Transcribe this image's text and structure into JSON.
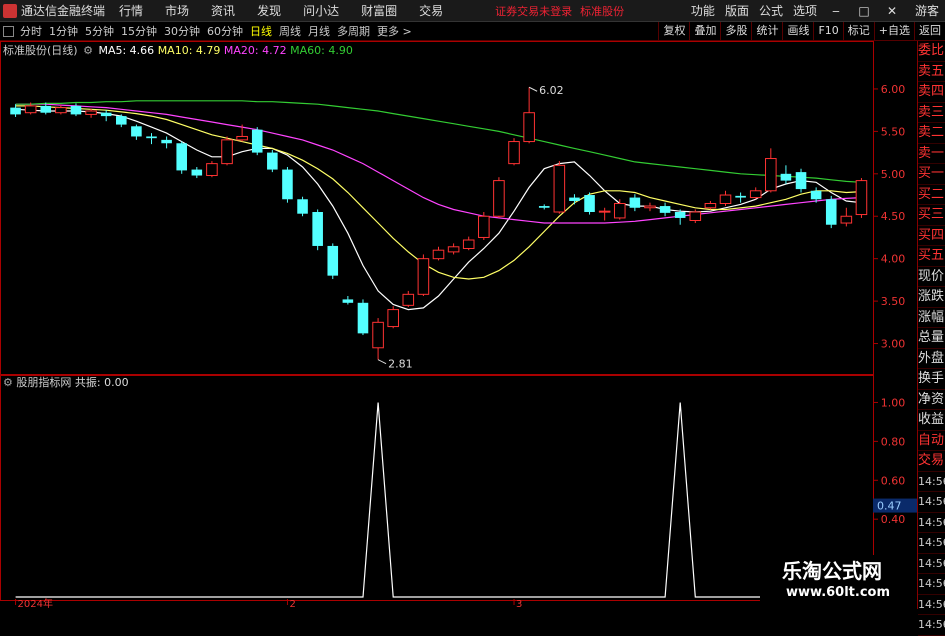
{
  "menubar": {
    "app_title": "通达信金融终端",
    "menus": [
      "行情",
      "市场",
      "资讯",
      "发现",
      "问小达",
      "财富圈",
      "交易"
    ],
    "warning": "证券交易未登录",
    "stock_name": "标准股份",
    "right_items": [
      "功能",
      "版面",
      "公式",
      "选项",
      "游客"
    ],
    "win_buttons": [
      "‒",
      "□",
      "✕"
    ]
  },
  "toolbar": {
    "periods": [
      "分时",
      "1分钟",
      "5分钟",
      "15分钟",
      "30分钟",
      "60分钟",
      "日线",
      "周线",
      "月线",
      "多周期",
      "更多 >"
    ],
    "active_period": "日线",
    "right_buttons": [
      "复权",
      "叠加",
      "多股",
      "统计",
      "画线",
      "F10",
      "标记",
      "+自选",
      "返回"
    ]
  },
  "legend_main": {
    "title": "标准股份(日线)",
    "ma5_label": "MA5: 4.66",
    "ma10_label": "MA10: 4.79",
    "ma20_label": "MA20: 4.72",
    "ma60_label": "MA60: 4.90"
  },
  "legend_sub": {
    "title": "股朋指标网",
    "value_label": "共振: 0.00"
  },
  "side_panel": {
    "items": [
      "委比",
      "卖五",
      "卖四",
      "卖三",
      "卖二",
      "卖一",
      "买一",
      "买二",
      "买三",
      "买四",
      "买五",
      "现价",
      "涨跌",
      "涨幅",
      "总量",
      "外盘",
      "换手",
      "净资",
      "收益",
      "自动",
      "交易",
      "14:56",
      "14:56",
      "14:56",
      "14:56",
      "14:56",
      "14:56",
      "14:56",
      "14:56"
    ],
    "highlight_value": "0.47"
  },
  "watermark": {
    "line1": "乐淘公式网",
    "line2": "www.60lt.com"
  },
  "colors": {
    "up": "#ff3333",
    "down": "#54ffff",
    "ma5": "#ffffff",
    "ma10": "#ffff66",
    "ma20": "#ff44ff",
    "ma60": "#33cc33",
    "axis": "#aa0000"
  },
  "chart_data": [
    {
      "type": "candlestick",
      "ylim": [
        2.7,
        6.4
      ],
      "yticks": [
        3.0,
        3.5,
        4.0,
        4.5,
        5.0,
        5.5,
        6.0
      ],
      "annotations": [
        {
          "label": "6.02",
          "index": 34,
          "value": 6.02
        },
        {
          "label": "2.81",
          "index": 24,
          "value": 2.81
        }
      ],
      "candles": [
        {
          "o": 5.78,
          "c": 5.7,
          "h": 5.82,
          "l": 5.67
        },
        {
          "o": 5.72,
          "c": 5.8,
          "h": 5.84,
          "l": 5.7
        },
        {
          "o": 5.8,
          "c": 5.72,
          "h": 5.84,
          "l": 5.7
        },
        {
          "o": 5.72,
          "c": 5.78,
          "h": 5.81,
          "l": 5.7
        },
        {
          "o": 5.8,
          "c": 5.7,
          "h": 5.83,
          "l": 5.68
        },
        {
          "o": 5.7,
          "c": 5.74,
          "h": 5.77,
          "l": 5.66
        },
        {
          "o": 5.72,
          "c": 5.68,
          "h": 5.75,
          "l": 5.62
        },
        {
          "o": 5.68,
          "c": 5.58,
          "h": 5.7,
          "l": 5.55
        },
        {
          "o": 5.56,
          "c": 5.44,
          "h": 5.58,
          "l": 5.4
        },
        {
          "o": 5.44,
          "c": 5.42,
          "h": 5.48,
          "l": 5.35
        },
        {
          "o": 5.4,
          "c": 5.36,
          "h": 5.44,
          "l": 5.3
        },
        {
          "o": 5.36,
          "c": 5.04,
          "h": 5.38,
          "l": 5.0
        },
        {
          "o": 5.05,
          "c": 4.98,
          "h": 5.08,
          "l": 4.95
        },
        {
          "o": 4.98,
          "c": 5.12,
          "h": 5.15,
          "l": 4.96
        },
        {
          "o": 5.12,
          "c": 5.4,
          "h": 5.44,
          "l": 5.1
        },
        {
          "o": 5.4,
          "c": 5.44,
          "h": 5.58,
          "l": 5.38
        },
        {
          "o": 5.52,
          "c": 5.25,
          "h": 5.55,
          "l": 5.22
        },
        {
          "o": 5.25,
          "c": 5.05,
          "h": 5.28,
          "l": 5.02
        },
        {
          "o": 5.05,
          "c": 4.7,
          "h": 5.08,
          "l": 4.66
        },
        {
          "o": 4.7,
          "c": 4.53,
          "h": 4.73,
          "l": 4.5
        },
        {
          "o": 4.55,
          "c": 4.15,
          "h": 4.58,
          "l": 4.1
        },
        {
          "o": 4.15,
          "c": 3.8,
          "h": 4.18,
          "l": 3.76
        },
        {
          "o": 3.52,
          "c": 3.48,
          "h": 3.56,
          "l": 3.46
        },
        {
          "o": 3.48,
          "c": 3.12,
          "h": 3.52,
          "l": 3.1
        },
        {
          "o": 2.95,
          "c": 3.25,
          "h": 3.3,
          "l": 2.81
        },
        {
          "o": 3.2,
          "c": 3.4,
          "h": 3.44,
          "l": 3.18
        },
        {
          "o": 3.45,
          "c": 3.58,
          "h": 3.62,
          "l": 3.43
        },
        {
          "o": 3.58,
          "c": 4.0,
          "h": 4.05,
          "l": 3.56
        },
        {
          "o": 4.0,
          "c": 4.1,
          "h": 4.14,
          "l": 3.98
        },
        {
          "o": 4.08,
          "c": 4.14,
          "h": 4.18,
          "l": 4.05
        },
        {
          "o": 4.12,
          "c": 4.22,
          "h": 4.26,
          "l": 4.1
        },
        {
          "o": 4.25,
          "c": 4.5,
          "h": 4.55,
          "l": 4.22
        },
        {
          "o": 4.5,
          "c": 4.92,
          "h": 4.96,
          "l": 4.48
        },
        {
          "o": 5.12,
          "c": 5.38,
          "h": 5.42,
          "l": 5.1
        },
        {
          "o": 5.38,
          "c": 5.72,
          "h": 6.02,
          "l": 5.36
        },
        {
          "o": 4.62,
          "c": 4.6,
          "h": 4.64,
          "l": 4.58
        },
        {
          "o": 4.55,
          "c": 5.1,
          "h": 5.15,
          "l": 4.53
        },
        {
          "o": 4.72,
          "c": 4.68,
          "h": 4.76,
          "l": 4.64
        },
        {
          "o": 4.75,
          "c": 4.55,
          "h": 4.78,
          "l": 4.52
        },
        {
          "o": 4.55,
          "c": 4.56,
          "h": 4.6,
          "l": 4.45
        },
        {
          "o": 4.48,
          "c": 4.65,
          "h": 4.7,
          "l": 4.46
        },
        {
          "o": 4.72,
          "c": 4.6,
          "h": 4.76,
          "l": 4.56
        },
        {
          "o": 4.6,
          "c": 4.62,
          "h": 4.66,
          "l": 4.56
        },
        {
          "o": 4.62,
          "c": 4.54,
          "h": 4.66,
          "l": 4.5
        },
        {
          "o": 4.55,
          "c": 4.48,
          "h": 4.58,
          "l": 4.4
        },
        {
          "o": 4.45,
          "c": 4.55,
          "h": 4.58,
          "l": 4.42
        },
        {
          "o": 4.6,
          "c": 4.65,
          "h": 4.68,
          "l": 4.58
        },
        {
          "o": 4.65,
          "c": 4.75,
          "h": 4.8,
          "l": 4.62
        },
        {
          "o": 4.74,
          "c": 4.72,
          "h": 4.78,
          "l": 4.66
        },
        {
          "o": 4.72,
          "c": 4.8,
          "h": 4.84,
          "l": 4.7
        },
        {
          "o": 4.8,
          "c": 5.18,
          "h": 5.3,
          "l": 4.78
        },
        {
          "o": 5.0,
          "c": 4.92,
          "h": 5.1,
          "l": 4.88
        },
        {
          "o": 5.02,
          "c": 4.82,
          "h": 5.06,
          "l": 4.78
        },
        {
          "o": 4.8,
          "c": 4.7,
          "h": 4.84,
          "l": 4.66
        },
        {
          "o": 4.7,
          "c": 4.4,
          "h": 4.74,
          "l": 4.36
        },
        {
          "o": 4.42,
          "c": 4.5,
          "h": 4.6,
          "l": 4.38
        },
        {
          "o": 4.52,
          "c": 4.92,
          "h": 4.95,
          "l": 4.48
        }
      ],
      "ma_series": [
        {
          "name": "MA5",
          "values": [
            5.76,
            5.75,
            5.74,
            5.74,
            5.74,
            5.73,
            5.71,
            5.68,
            5.62,
            5.55,
            5.48,
            5.38,
            5.28,
            5.2,
            5.2,
            5.26,
            5.3,
            5.3,
            5.22,
            5.08,
            4.88,
            4.62,
            4.3,
            3.92,
            3.62,
            3.46,
            3.4,
            3.42,
            3.56,
            3.76,
            3.96,
            4.12,
            4.3,
            4.56,
            4.84,
            5.06,
            5.12,
            5.14,
            4.98,
            4.8,
            4.65,
            4.62,
            4.62,
            4.58,
            4.56,
            4.55,
            4.56,
            4.6,
            4.64,
            4.7,
            4.82,
            4.88,
            4.92,
            4.9,
            4.78,
            4.68,
            4.66
          ]
        },
        {
          "name": "MA10",
          "values": [
            5.8,
            5.8,
            5.79,
            5.78,
            5.77,
            5.76,
            5.75,
            5.73,
            5.71,
            5.68,
            5.64,
            5.58,
            5.52,
            5.46,
            5.42,
            5.38,
            5.34,
            5.3,
            5.24,
            5.16,
            5.06,
            4.94,
            4.78,
            4.6,
            4.42,
            4.24,
            4.08,
            3.94,
            3.84,
            3.78,
            3.76,
            3.78,
            3.86,
            3.98,
            4.14,
            4.32,
            4.5,
            4.66,
            4.76,
            4.8,
            4.8,
            4.78,
            4.72,
            4.68,
            4.64,
            4.6,
            4.58,
            4.58,
            4.6,
            4.62,
            4.66,
            4.7,
            4.76,
            4.8,
            4.8,
            4.78,
            4.79
          ]
        },
        {
          "name": "MA20",
          "values": [
            5.82,
            5.82,
            5.82,
            5.81,
            5.8,
            5.79,
            5.78,
            5.76,
            5.74,
            5.72,
            5.7,
            5.67,
            5.64,
            5.61,
            5.58,
            5.55,
            5.52,
            5.48,
            5.44,
            5.4,
            5.34,
            5.28,
            5.2,
            5.12,
            5.02,
            4.92,
            4.82,
            4.72,
            4.64,
            4.58,
            4.54,
            4.5,
            4.48,
            4.46,
            4.44,
            4.42,
            4.42,
            4.42,
            4.42,
            4.42,
            4.43,
            4.44,
            4.46,
            4.48,
            4.5,
            4.52,
            4.54,
            4.56,
            4.58,
            4.6,
            4.62,
            4.64,
            4.66,
            4.68,
            4.7,
            4.71,
            4.72
          ]
        },
        {
          "name": "MA60",
          "values": [
            5.82,
            5.82,
            5.83,
            5.83,
            5.84,
            5.84,
            5.85,
            5.85,
            5.86,
            5.86,
            5.86,
            5.86,
            5.86,
            5.86,
            5.86,
            5.86,
            5.85,
            5.85,
            5.84,
            5.83,
            5.82,
            5.8,
            5.78,
            5.76,
            5.74,
            5.71,
            5.68,
            5.65,
            5.62,
            5.59,
            5.56,
            5.53,
            5.5,
            5.46,
            5.42,
            5.38,
            5.34,
            5.3,
            5.26,
            5.22,
            5.18,
            5.14,
            5.12,
            5.1,
            5.08,
            5.06,
            5.04,
            5.02,
            5.0,
            4.99,
            4.98,
            4.97,
            4.96,
            4.95,
            4.93,
            4.91,
            4.9
          ]
        }
      ],
      "x_labels": [
        {
          "label": "2024年",
          "index": 0
        },
        {
          "label": "2",
          "index": 18
        },
        {
          "label": "3",
          "index": 33
        }
      ]
    },
    {
      "type": "line",
      "name": "共振",
      "ylim": [
        0,
        1.1
      ],
      "yticks": [
        0.4,
        0.6,
        0.8,
        1.0
      ],
      "values": [
        0,
        0,
        0,
        0,
        0,
        0,
        0,
        0,
        0,
        0,
        0,
        0,
        0,
        0,
        0,
        0,
        0,
        0,
        0,
        0,
        0,
        0,
        0,
        0,
        1,
        0,
        0,
        0,
        0,
        0,
        0,
        0,
        0,
        0,
        0,
        0,
        0,
        0,
        0,
        0,
        0,
        0,
        0,
        0,
        1,
        0,
        0,
        0,
        0,
        0,
        0,
        0,
        0,
        0,
        0,
        0,
        0
      ]
    }
  ]
}
